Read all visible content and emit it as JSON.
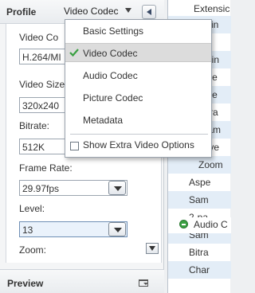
{
  "profile": {
    "title": "Profile",
    "selected": "Video Codec"
  },
  "settings": {
    "video_codec_label": "Video Co",
    "video_codec_value": "H.264/MI",
    "video_size_label": "Video Size",
    "video_size_value": "320x240",
    "bitrate_label": "Bitrate:",
    "bitrate_value": "512K",
    "frame_rate_label": "Frame Rate:",
    "frame_rate_value": "29.97fps",
    "level_label": "Level:",
    "level_value": "13",
    "zoom_label": "Zoom:"
  },
  "preview": {
    "title": "Preview"
  },
  "menu": {
    "items": [
      {
        "label": "Basic Settings",
        "checked": false
      },
      {
        "label": "Video Codec",
        "checked": true
      },
      {
        "label": "Audio Codec",
        "checked": false
      },
      {
        "label": "Picture Codec",
        "checked": false
      },
      {
        "label": "Metadata",
        "checked": false
      }
    ],
    "option_label": "Show Extra Video Options"
  },
  "right_list": [
    "Extensic",
    "s Tin",
    "ath",
    "ntain",
    "Vide",
    "Vide",
    "Bitra",
    "Fram",
    "Leve",
    "Zoom",
    "Aspe",
    "Sam",
    "2-pa",
    "Audio C",
    "Sam",
    "Bitra",
    "Char"
  ],
  "colors": {
    "menu_active_bg": "#dcdcdc",
    "row_alt_bg": "#e3edf7",
    "check_green": "#3aa042"
  }
}
